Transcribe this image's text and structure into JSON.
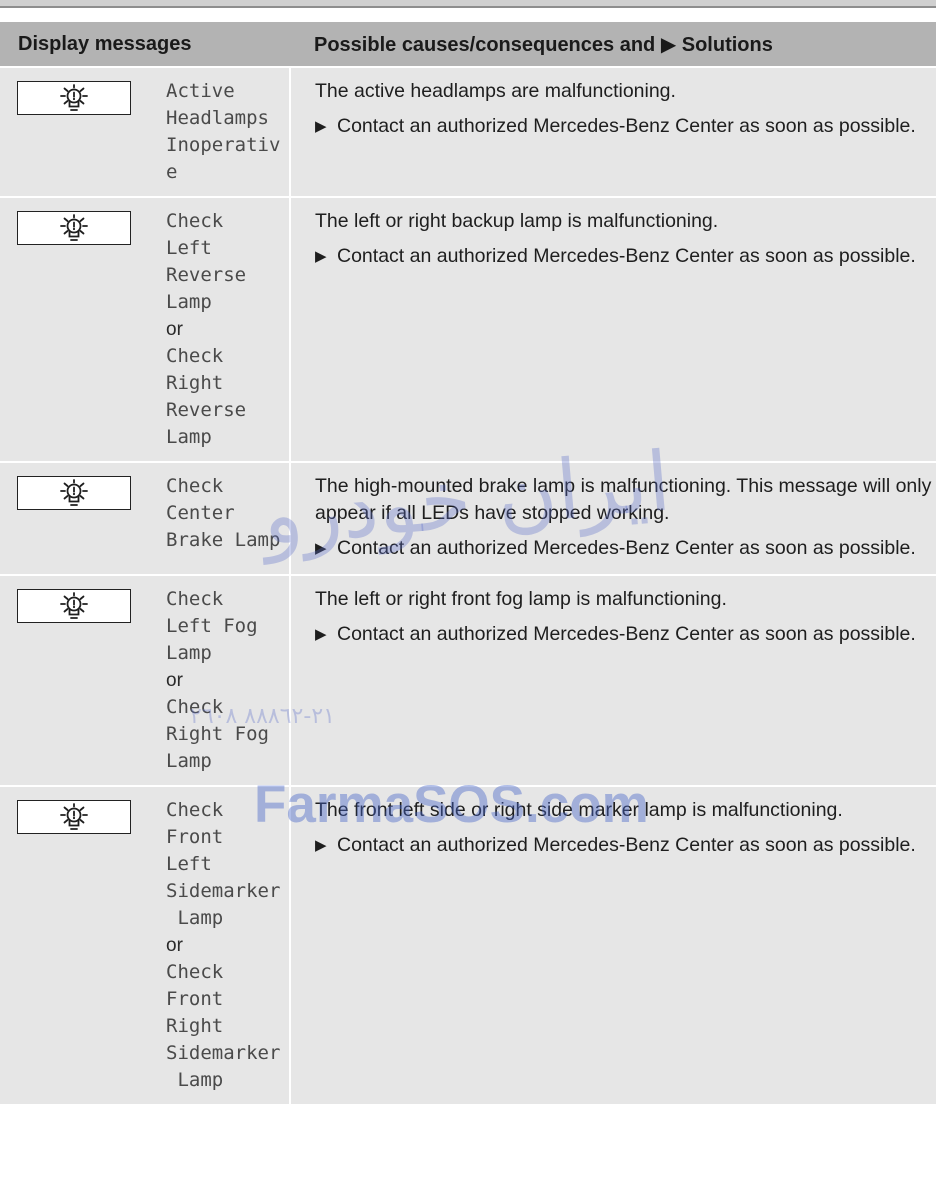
{
  "table": {
    "headers": {
      "display": "Display messages",
      "solutions": "Possible causes/consequences and ▶ Solutions"
    },
    "rows": [
      {
        "icon": "exterior-lamp-warning-icon",
        "message_lines": [
          "Active",
          "Headlamps",
          "Inoperativ",
          "e"
        ],
        "cause": "The active headlamps are malfunctioning.",
        "solution": "Contact an authorized Mercedes-Benz Center as soon as possible."
      },
      {
        "icon": "exterior-lamp-warning-icon",
        "message_lines": [
          "Check",
          "Left",
          "Reverse",
          "Lamp",
          "or",
          "Check",
          "Right",
          "Reverse",
          "Lamp"
        ],
        "cause": "The left or right backup lamp is malfunctioning.",
        "solution": "Contact an authorized Mercedes-Benz Center as soon as possible."
      },
      {
        "icon": "exterior-lamp-warning-icon",
        "message_lines": [
          "Check",
          "Center",
          "Brake Lamp"
        ],
        "cause": "The high-mounted brake lamp is malfunctioning. This message will only appear if all LEDs have stopped working.",
        "solution": "Contact an authorized Mercedes-Benz Center as soon as possible."
      },
      {
        "icon": "exterior-lamp-warning-icon",
        "message_lines": [
          "Check",
          "Left Fog",
          "Lamp",
          "or",
          "Check",
          "Right Fog",
          "Lamp"
        ],
        "cause": "The left or right front fog lamp is malfunctioning.",
        "solution": "Contact an authorized Mercedes-Benz Center as soon as possible."
      },
      {
        "icon": "exterior-lamp-warning-icon",
        "message_lines": [
          "Check",
          "Front",
          "Left",
          "Sidemarker",
          " Lamp",
          "or",
          "Check",
          "Front",
          "Right",
          "Sidemarker",
          " Lamp"
        ],
        "cause": "The front left side or right side marker lamp is malfunctioning.",
        "solution": "Contact an authorized Mercedes-Benz Center as soon as possible."
      }
    ]
  },
  "watermark": {
    "arabic": "ایران خودرو",
    "phone": "٢١-٨٨٨٦٢ ٢٦٠٨",
    "site": "FarmaSOS.com"
  }
}
